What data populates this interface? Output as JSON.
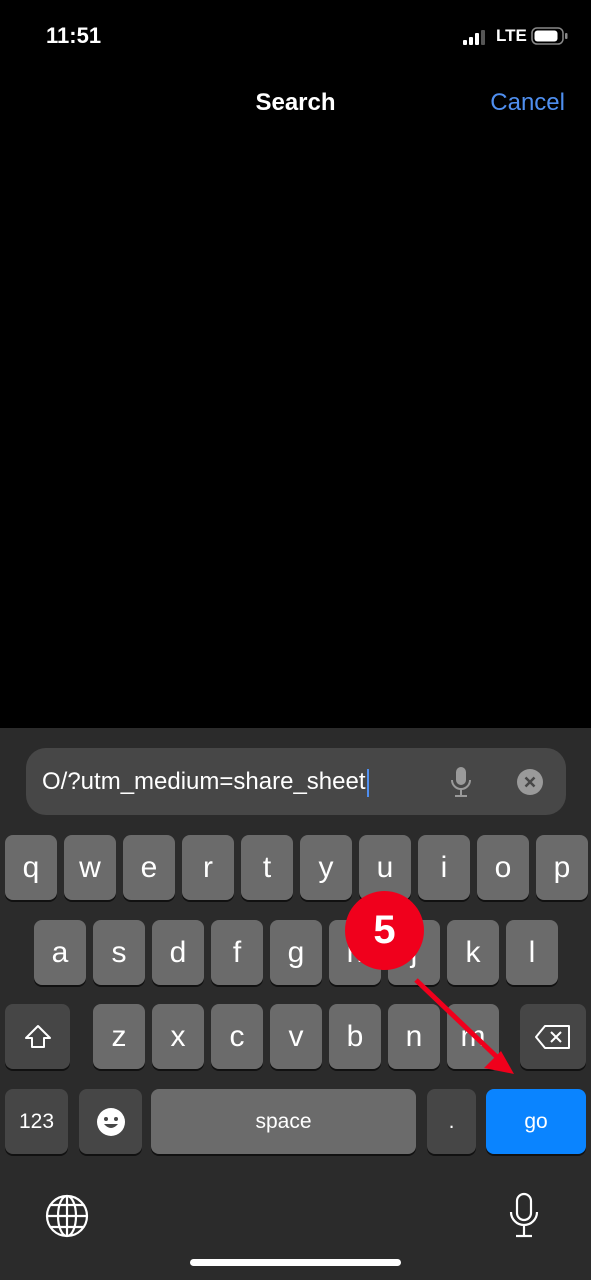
{
  "status": {
    "time": "11:51",
    "network": "LTE",
    "signal_bars": 3,
    "battery_level": 0.8
  },
  "header": {
    "title": "Search",
    "cancel_label": "Cancel"
  },
  "search": {
    "value": "O/?utm_medium=share_sheet",
    "mic_icon": "microphone-icon",
    "clear_icon": "clear-circle-icon"
  },
  "keyboard": {
    "row1": [
      "q",
      "w",
      "e",
      "r",
      "t",
      "y",
      "u",
      "i",
      "o",
      "p"
    ],
    "row2": [
      "a",
      "s",
      "d",
      "f",
      "g",
      "h",
      "j",
      "k",
      "l"
    ],
    "row3": [
      "z",
      "x",
      "c",
      "v",
      "b",
      "n",
      "m"
    ],
    "numbers_label": "123",
    "space_label": "space",
    "period_label": ".",
    "go_label": "go"
  },
  "annotation": {
    "step": "5",
    "color": "#f0001c"
  },
  "colors": {
    "accent": "#4f8ff0",
    "go_key": "#0a84ff"
  }
}
